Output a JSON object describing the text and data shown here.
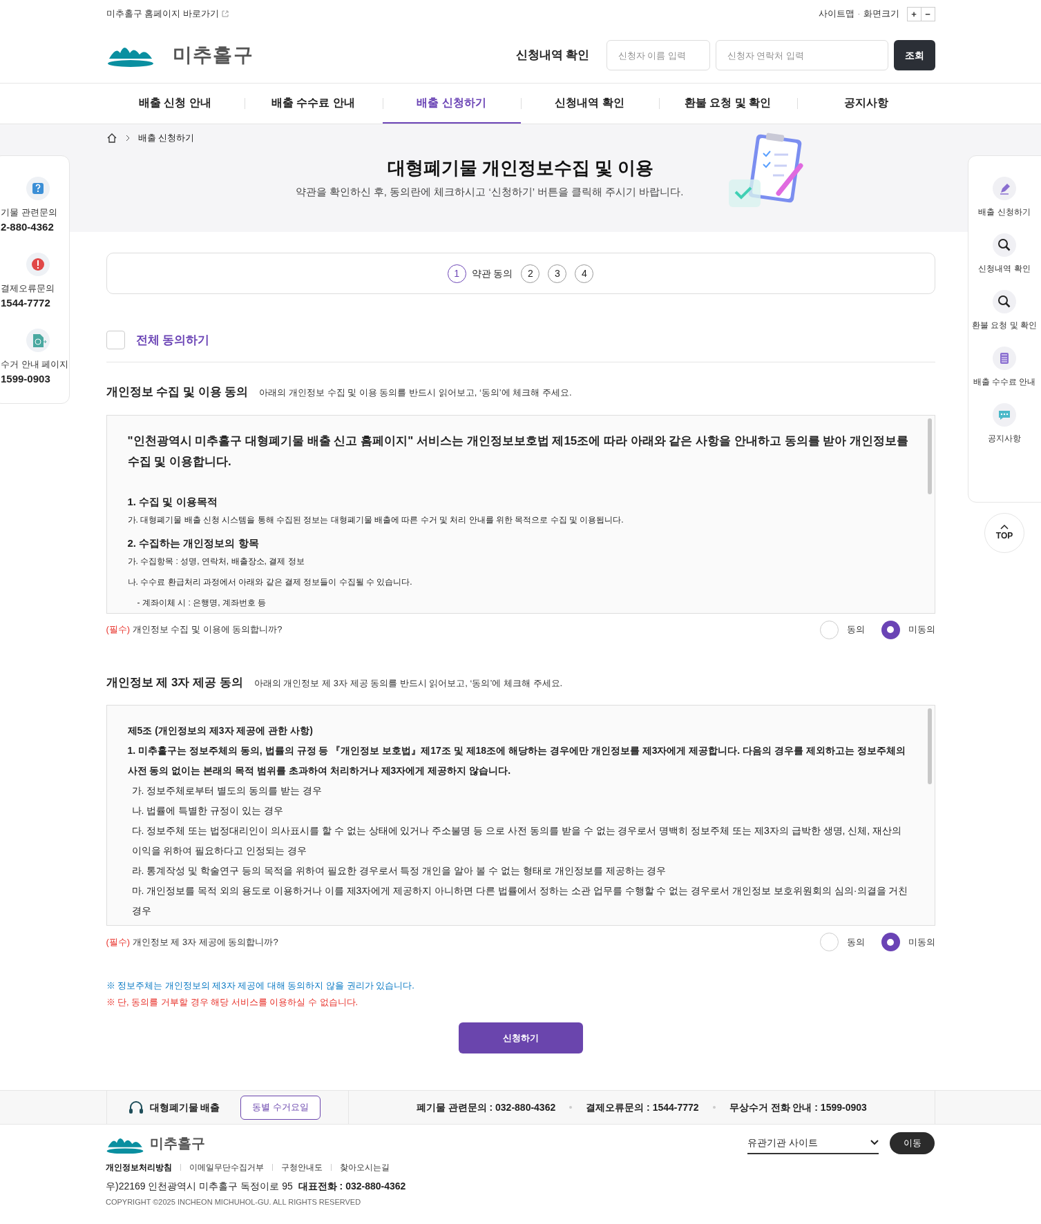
{
  "top_bar": {
    "home_link": "미추홀구 홈페이지 바로가기",
    "sitemap": "사이트맵",
    "separator": "·",
    "font_size": "화면크기",
    "zoom_buttons": [
      "+",
      "−"
    ]
  },
  "header": {
    "logo": "미추홀구",
    "lookup_label": "신청내역 확인",
    "name_placeholder": "신청자 이름 입력",
    "phone_placeholder": "신청자 연락처 입력",
    "lookup_button": "조회"
  },
  "nav": [
    {
      "label": "배출 신청 안내",
      "selected": false
    },
    {
      "label": "배출 수수료 안내",
      "selected": false
    },
    {
      "label": "배출 신청하기",
      "selected": true
    },
    {
      "label": "신청내역 확인",
      "selected": false
    },
    {
      "label": "환불 요청 및 확인",
      "selected": false
    },
    {
      "label": "공지사항",
      "selected": false
    }
  ],
  "breadcrumb": "배출 신청하기",
  "hero": {
    "title": "대형폐기물 개인정보수집 및 이용",
    "subtitle": "약관을 확인하신 후, 동의란에 체크하시고 ‘신청하기’ 버튼을 클릭해 주시기 바랍니다."
  },
  "left_panel": [
    {
      "kind": "question",
      "label": "기물 관련문의",
      "phone": "2-880-4362"
    },
    {
      "kind": "alert",
      "label": "결제오류문의",
      "phone": "1544-7772"
    },
    {
      "kind": "page",
      "label": "수거 안내 페이지",
      "phone": "1599-0903"
    }
  ],
  "right_panel": [
    {
      "kind": "pencil",
      "label": "배출 신청하기"
    },
    {
      "kind": "search",
      "label": "신청내역 확인"
    },
    {
      "kind": "search",
      "label": "환불 요청 및 확인"
    },
    {
      "kind": "calculator",
      "label": "배출 수수료 안내"
    },
    {
      "kind": "chat",
      "label": "공지사항"
    }
  ],
  "top_button": "TOP",
  "steps": [
    {
      "number": "1",
      "label": "약관 동의",
      "selected": true
    },
    {
      "number": "2",
      "selected": false
    },
    {
      "number": "3",
      "selected": false
    },
    {
      "number": "4",
      "selected": false
    }
  ],
  "agree_all": {
    "label": "전체 동의하기",
    "checked": false
  },
  "sections": [
    {
      "title": "개인정보 수집 및 이용 동의",
      "note": "아래의 개인정보 수집 및 이용 동의를 반드시 읽어보고, ‘동의’에 체크해 주세요.",
      "paragraphs": [
        {
          "kind": "lead",
          "text": "\"인천광역시 미추홀구 대형폐기물 배출 신고 홈페이지\" 서비스는 개인정보보호법 제15조에 따라 아래와 같은 사항을 안내하고 동의를 받아 개인정보를 수집 및 이용합니다."
        },
        {
          "kind": "heading",
          "text": "1. 수집 및 이용목적"
        },
        {
          "kind": "body",
          "text": "가. 대형폐기물 배출 신청 시스템을 통해 수집된 정보는 대형폐기물 배출에 따른 수거 및 처리 안내를 위한 목적으로 수집 및 이용됩니다."
        },
        {
          "kind": "heading",
          "text": "2. 수집하는 개인정보의 항목"
        },
        {
          "kind": "body",
          "text": "가. 수집항목 : 성명, 연락처, 배출장소, 결제 정보"
        },
        {
          "kind": "body",
          "text": "나. 수수료 환급처리 과정에서 아래와 같은 결제 정보들이 수집될 수 있습니다."
        },
        {
          "kind": "indent",
          "text": "- 계좌이체 시 : 은행명, 계좌번호 등"
        }
      ],
      "question": {
        "required": "(필수)",
        "text": "개인정보 수집 및 이용에 동의합니까?"
      },
      "options": [
        {
          "label": "동의",
          "selected": false
        },
        {
          "label": "미동의",
          "selected": true
        }
      ]
    },
    {
      "title": "개인정보 제 3자 제공 동의",
      "note": "아래의 개인정보 제 3자 제공 동의를 반드시 읽어보고, ‘동의’에 체크해 주세요.",
      "paragraphs": [
        {
          "kind": "bold",
          "text": "제5조 (개인정보의 제3자 제공에 관한 사항)"
        },
        {
          "kind": "bold",
          "text": "1. 미추홀구는 정보주체의 동의, 법률의 규정 등 『개인정보 보호법』제17조 및 제18조에 해당하는 경우에만 개인정보를 제3자에게 제공합니다.  다음의 경우를 제외하고는 정보주체의 사전 동의 없이는 본래의 목적 범위를 초과하여 처리하거나 제3자에게 제공하지 않습니다."
        },
        {
          "kind": "item",
          "text": "가. 정보주체로부터 별도의 동의를 받는 경우"
        },
        {
          "kind": "item",
          "text": "나. 법률에 특별한 규정이 있는 경우"
        },
        {
          "kind": "item",
          "text": "다. 정보주체 또는 법정대리인이 의사표시를 할 수 없는 상태에 있거나 주소불명 등 으로 사전 동의를 받을 수 없는 경우로서 명백히 정보주체 또는 제3자의 급박한 생명, 신체, 재산의 이익을 위하여 필요하다고 인정되는 경우"
        },
        {
          "kind": "item",
          "text": "라. 통계작성 및 학술연구 등의 목적을 위하여 필요한 경우로서 특정 개인을 알아 볼 수 없는 형태로 개인정보를 제공하는 경우"
        },
        {
          "kind": "item",
          "text": "마. 개인정보를 목적 외의 용도로 이용하거나 이를 제3자에게 제공하지 아니하면 다른 법률에서 정하는 소관 업무를 수행할 수 없는 경우로서 개인정보 보호위원회의 심의·의결을 거친 경우"
        }
      ],
      "question": {
        "required": "(필수)",
        "text": "개인정보 제 3자 제공에 동의합니까?"
      },
      "options": [
        {
          "label": "동의",
          "selected": false
        },
        {
          "label": "미동의",
          "selected": true
        }
      ]
    }
  ],
  "notices": [
    {
      "mark": "※",
      "text": "정보주체는 개인정보의 제3자 제공에 대해 동의하지 않을 권리가 있습니다.",
      "color": "#0a7ac4"
    },
    {
      "mark": "※",
      "text": "단, 동의를 거부할 경우 해당 서비스를 이용하실 수 없습니다.",
      "color": "#e8322b"
    }
  ],
  "submit": "신청하기",
  "footer_bar": {
    "title": "대형폐기물 배출",
    "button": "동별 수거요일",
    "contacts": [
      "폐기물 관련문의 : 032-880-4362",
      "결제오류문의 : 1544-7772",
      "무상수거 전화 안내 : 1599-0903"
    ]
  },
  "footer": {
    "logo": "미추홀구",
    "site_select": "유관기관 사이트",
    "go_button": "이동",
    "links": [
      {
        "label": "개인정보처리방침",
        "bold": true
      },
      {
        "label": "이메일무단수집거부",
        "bold": false
      },
      {
        "label": "구청안내도",
        "bold": false
      },
      {
        "label": "찾아오시는길",
        "bold": false
      }
    ],
    "address": "우)22169 인천광역시 미추홀구 독정이로 95",
    "phone": "대표전화 : 032-880-4362",
    "copyright": "COPYRIGHT ©2025 INCHEON MICHUHOL-GU. ALL RIGHTS RESERVED"
  }
}
